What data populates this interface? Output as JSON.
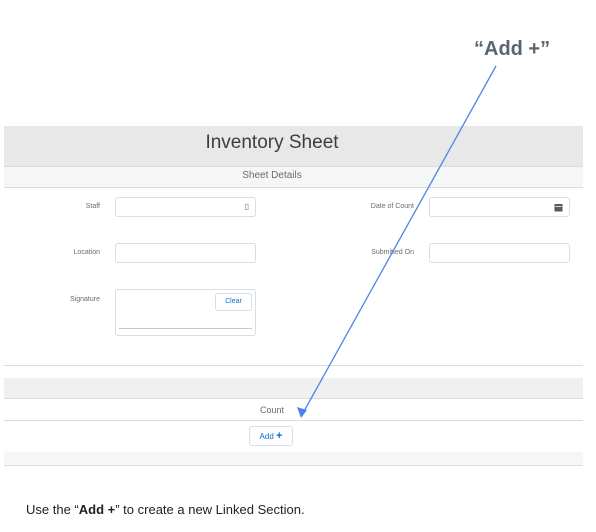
{
  "callout": "“Add +”",
  "form": {
    "title": "Inventory Sheet",
    "section_title": "Sheet Details",
    "fields": {
      "staff": {
        "label": "Staff",
        "value": ""
      },
      "date_of_count": {
        "label": "Date of Count",
        "value": ""
      },
      "location": {
        "label": "Location",
        "value": ""
      },
      "submitted_on": {
        "label": "Submitted On",
        "value": ""
      },
      "signature": {
        "label": "Signature",
        "clear_label": "Clear"
      }
    },
    "count_section": {
      "title": "Count",
      "add_label": "Add",
      "add_symbol": "+"
    }
  },
  "instruction": {
    "prefix": "Use the “",
    "bold": "Add +",
    "suffix": "” to create a new Linked Section."
  },
  "colors": {
    "arrow": "#4a86e8",
    "link": "#0070d2",
    "band": "#e8e8e8"
  }
}
